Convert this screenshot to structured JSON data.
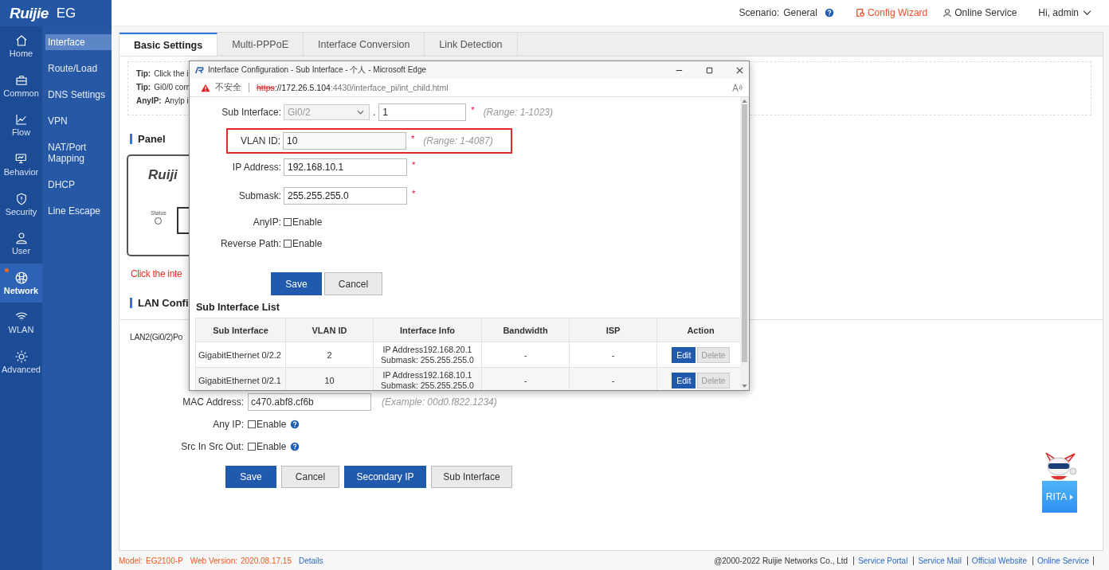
{
  "brand": {
    "logo": "Ruijie",
    "product": "EG"
  },
  "header": {
    "scenario_label": "Scenario:",
    "scenario": "General",
    "config_wizard": "Config Wizard",
    "online_service": "Online Service",
    "user": "Hi, admin"
  },
  "nav": [
    {
      "label": "Home",
      "selected": false,
      "alert": false
    },
    {
      "label": "Common",
      "selected": false,
      "alert": false
    },
    {
      "label": "Flow",
      "selected": false,
      "alert": false
    },
    {
      "label": "Behavior",
      "selected": false,
      "alert": false
    },
    {
      "label": "Security",
      "selected": false,
      "alert": false
    },
    {
      "label": "User",
      "selected": false,
      "alert": false
    },
    {
      "label": "Network",
      "selected": true,
      "alert": true
    },
    {
      "label": "WLAN",
      "selected": false,
      "alert": false
    },
    {
      "label": "Advanced",
      "selected": false,
      "alert": false
    }
  ],
  "submenu": [
    {
      "label": "Interface",
      "selected": true
    },
    {
      "label": "Route/Load",
      "selected": false
    },
    {
      "label": "DNS Settings",
      "selected": false
    },
    {
      "label": "VPN",
      "selected": false
    },
    {
      "label": "NAT/Port Mapping",
      "selected": false
    },
    {
      "label": "DHCP",
      "selected": false
    },
    {
      "label": "Line Escape",
      "selected": false
    }
  ],
  "tabs": [
    {
      "label": "Basic Settings",
      "selected": true
    },
    {
      "label": "Multi-PPPoE",
      "selected": false
    },
    {
      "label": "Interface Conversion",
      "selected": false
    },
    {
      "label": "Link Detection",
      "selected": false
    }
  ],
  "tips": [
    {
      "label": "Tip:",
      "text": "Click the i"
    },
    {
      "label": "Tip:",
      "text": "Gi0/0 corr"
    },
    {
      "label": "AnyIP:",
      "text": "Anylp i"
    }
  ],
  "panel": {
    "title": "Panel",
    "device_brand": "Ruiji",
    "status_label": "Status",
    "hint": "Click the inte"
  },
  "lan": {
    "title": "LAN Confi",
    "port": "LAN2(Gi0/2)Po",
    "fields": [
      {
        "kind": "text",
        "label": "MAC Address:",
        "value": "c470.abf8.cf6b",
        "hint": "(Example: 00d0.f822.1234)"
      },
      {
        "kind": "checkbox",
        "label": "Any IP:",
        "option": "Enable",
        "checked": false
      },
      {
        "kind": "checkbox",
        "label": "Src In Src Out:",
        "option": "Enable",
        "checked": false
      }
    ],
    "buttons": [
      {
        "label": "Save",
        "kind": "primary"
      },
      {
        "label": "Cancel",
        "kind": "default"
      },
      {
        "label": "Secondary IP",
        "kind": "primary"
      },
      {
        "label": "Sub Interface",
        "kind": "default"
      }
    ]
  },
  "footer": {
    "model_label": "Model:",
    "model": "EG2100-P",
    "version_label": "Web Version:",
    "version": "2020.08.17.15",
    "details": "Details",
    "copyright": "@2000-2022 Ruijie Networks Co., Ltd",
    "links": [
      "Service Portal",
      "Service Mail",
      "Official Website",
      "Online Service"
    ]
  },
  "assistant": {
    "label": "RITA"
  },
  "popup": {
    "title": "Interface Configuration - Sub Interface - 个人 - Microsoft Edge",
    "security": "不安全",
    "url_scheme": "https",
    "url_host": "://172.26.5.104",
    "url_path": ":4430/interface_pi/int_child.html",
    "fields": [
      {
        "kind": "select",
        "label": "Sub Interface:",
        "value": "Gi0/2",
        "disabled": true,
        "separator": ".",
        "suffix_value": "1",
        "required_mark": "*",
        "hint": "(Range: 1-1023)",
        "highlighted": false
      },
      {
        "kind": "text",
        "label": "VLAN ID:",
        "value": "10",
        "required_mark": "*",
        "hint": "(Range: 1-4087)",
        "highlighted": true
      },
      {
        "kind": "text",
        "label": "IP Address:",
        "value": "192.168.10.1",
        "required_mark": "*",
        "highlighted": false
      },
      {
        "kind": "text",
        "label": "Submask:",
        "value": "255.255.255.0",
        "required_mark": "*",
        "highlighted": false
      },
      {
        "kind": "checkbox",
        "label": "AnyIP:",
        "option": "Enable",
        "checked": false,
        "highlighted": false
      },
      {
        "kind": "checkbox",
        "label": "Reverse Path:",
        "option": "Enable",
        "checked": false,
        "highlighted": false
      }
    ],
    "buttons": [
      {
        "label": "Save",
        "kind": "primary"
      },
      {
        "label": "Cancel",
        "kind": "default"
      }
    ],
    "list_title": "Sub Interface List",
    "columns": [
      "Sub Interface",
      "VLAN ID",
      "Interface Info",
      "Bandwidth",
      "ISP",
      "Action"
    ],
    "rows": [
      {
        "sub_interface": "GigabitEthernet 0/2.2",
        "vlan_id": "2",
        "ip": "IP Address192.168.20.1",
        "mask": "Submask: 255.255.255.0",
        "bandwidth": "-",
        "isp": "-",
        "edit": "Edit",
        "delete": "Delete"
      },
      {
        "sub_interface": "GigabitEthernet 0/2.1",
        "vlan_id": "10",
        "ip": "IP Address192.168.10.1",
        "mask": "Submask: 255.255.255.0",
        "bandwidth": "-",
        "isp": "-",
        "edit": "Edit",
        "delete": "Delete"
      }
    ]
  }
}
